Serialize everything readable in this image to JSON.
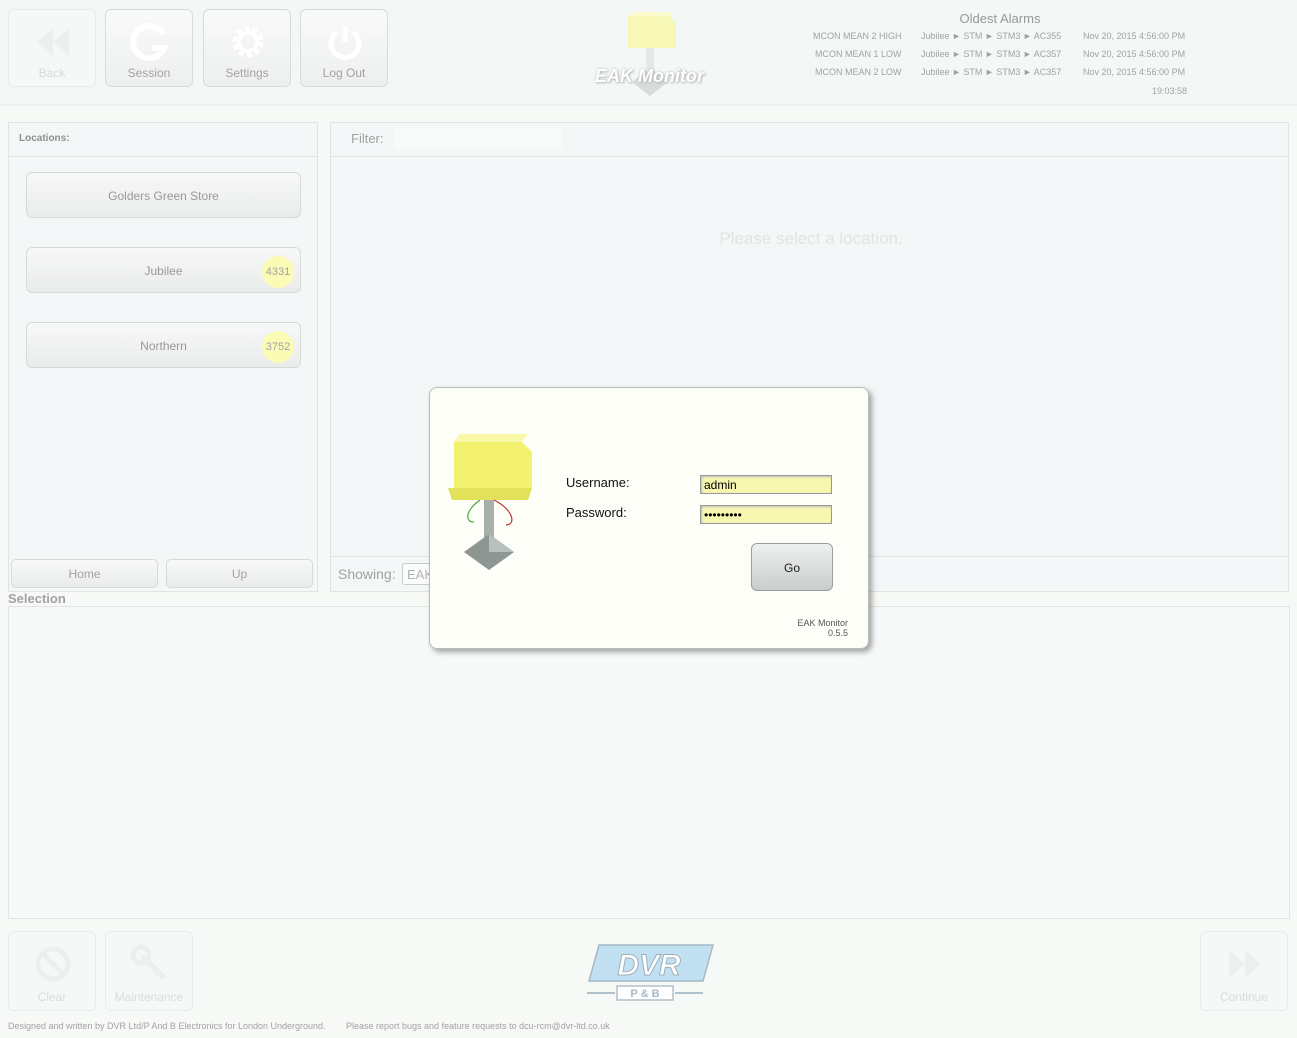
{
  "toolbar": {
    "back_label": "Back",
    "session_label": "Session",
    "settings_label": "Settings",
    "logout_label": "Log Out"
  },
  "logo": {
    "title": "EAK Monitor"
  },
  "alarms": {
    "title": "Oldest Alarms",
    "rows": [
      {
        "type": "MCON MEAN 2 HIGH",
        "path": "Jubilee ► STM ► STM3 ► AC355",
        "time": "Nov 20, 2015 4:56:00 PM"
      },
      {
        "type": "MCON MEAN 1 LOW",
        "path": "Jubilee ► STM ► STM3 ► AC357",
        "time": "Nov 20, 2015 4:56:00 PM"
      },
      {
        "type": "MCON MEAN 2 LOW",
        "path": "Jubilee ► STM ► STM3 ► AC357",
        "time": "Nov 20, 2015 4:56:00 PM"
      }
    ],
    "clock": "19:03:58"
  },
  "locations": {
    "title": "Locations:",
    "items": [
      {
        "label": "Golders Green Store",
        "count": ""
      },
      {
        "label": "Jubilee",
        "count": "4331"
      },
      {
        "label": "Northern",
        "count": "3752"
      }
    ],
    "home_label": "Home",
    "up_label": "Up"
  },
  "list": {
    "filter_label": "Filter:",
    "filter_value": "",
    "placeholder": "Please select a location.",
    "showing_label": "Showing:",
    "showing_value": "EAK"
  },
  "selection": {
    "title": "Selection"
  },
  "footer": {
    "clear_label": "Clear",
    "maintenance_label": "Maintenance",
    "continue_label": "Continue",
    "credits": "Designed and written by DVR Ltd/P And B Electronics for London Underground.",
    "bugs": "Please report bugs and feature requests to dcu-rcm@dvr-ltd.co.uk",
    "logo_text": "DVR",
    "logo_sub": "P & B"
  },
  "login": {
    "username_label": "Username:",
    "username_value": "admin",
    "password_label": "Password:",
    "password_value": "•••••••••",
    "go_label": "Go",
    "app_name": "EAK Monitor",
    "app_version": "0.5.5"
  }
}
